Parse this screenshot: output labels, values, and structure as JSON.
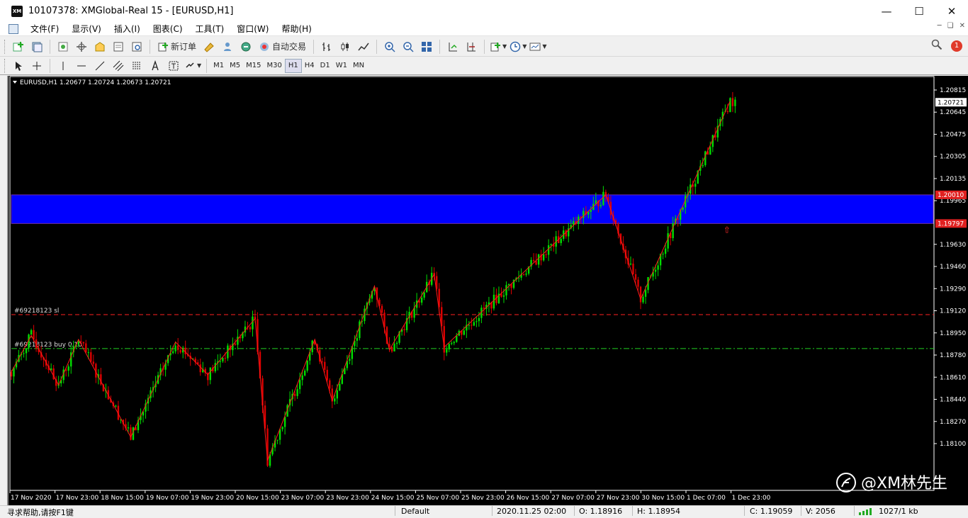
{
  "window": {
    "title": "10107378: XMGlobal-Real 15 - [EURUSD,H1]",
    "app_badge": "XM"
  },
  "menu": [
    "文件(F)",
    "显示(V)",
    "插入(I)",
    "图表(C)",
    "工具(T)",
    "窗口(W)",
    "帮助(H)"
  ],
  "toolbar": {
    "new_order_label": "新订单",
    "auto_trading_label": "自动交易",
    "notification_count": "1",
    "timeframes": [
      "M1",
      "M5",
      "M15",
      "M30",
      "H1",
      "H4",
      "D1",
      "W1",
      "MN"
    ],
    "active_timeframe": "H1"
  },
  "chart_data": {
    "type": "candlestick",
    "symbol_header": "EURUSD,H1  1.20677 1.20724 1.20673 1.20721",
    "price_ticks": [
      "1.20815",
      "1.20645",
      "1.20475",
      "1.20305",
      "1.20135",
      "1.19965",
      "1.19630",
      "1.19460",
      "1.19290",
      "1.19120",
      "1.18950",
      "1.18780",
      "1.18610",
      "1.18440",
      "1.18270",
      "1.18100"
    ],
    "price_tick_values": [
      1.20815,
      1.20645,
      1.20475,
      1.20305,
      1.20135,
      1.19965,
      1.1963,
      1.1946,
      1.1929,
      1.1912,
      1.1895,
      1.1878,
      1.1861,
      1.1844,
      1.1827,
      1.181
    ],
    "time_labels": [
      "17 Nov 2020",
      "17 Nov 23:00",
      "18 Nov 15:00",
      "19 Nov 07:00",
      "19 Nov 23:00",
      "20 Nov 15:00",
      "23 Nov 07:00",
      "23 Nov 23:00",
      "24 Nov 15:00",
      "25 Nov 07:00",
      "25 Nov 23:00",
      "26 Nov 15:00",
      "27 Nov 07:00",
      "27 Nov 23:00",
      "30 Nov 15:00",
      "1 Dec 07:00",
      "1 Dec 23:00"
    ],
    "current_price_label": "1.20721",
    "current_price": 1.20721,
    "zone": {
      "top": 1.2001,
      "bottom": 1.1979,
      "top_label": "1.20010",
      "bottom_label": "1.19797",
      "color": "#0000ff"
    },
    "order_lines": [
      {
        "label": "#69218123 sl",
        "price": 1.1909,
        "color": "#ff2020",
        "style": "dash"
      },
      {
        "label": "#69218123 buy 0.10",
        "price": 1.1883,
        "color": "#20d020",
        "style": "dashdot"
      }
    ],
    "zigzag": [
      [
        0,
        1.1865
      ],
      [
        8,
        1.1893
      ],
      [
        19,
        1.1855
      ],
      [
        27,
        1.189
      ],
      [
        48,
        1.1815
      ],
      [
        66,
        1.1888
      ],
      [
        79,
        1.1863
      ],
      [
        98,
        1.1906
      ],
      [
        103,
        1.1797
      ],
      [
        122,
        1.189
      ],
      [
        129,
        1.1843
      ],
      [
        146,
        1.1931
      ],
      [
        152,
        1.1882
      ],
      [
        170,
        1.194
      ],
      [
        174,
        1.1884
      ],
      [
        239,
        1.2001
      ],
      [
        253,
        1.1921
      ],
      [
        289,
        1.2073
      ]
    ],
    "bull_color": "#00dd00",
    "bear_color": "#dd0000",
    "arrow_label": "⇧",
    "watermark": "@XM林先生"
  },
  "status": {
    "help": "寻求帮助,请按F1键",
    "profile": "Default",
    "datetime": "2020.11.25 02:00",
    "open": "O: 1.18916",
    "high": "H: 1.18954",
    "close": "C: 1.19059",
    "volume": "V: 2056",
    "traffic": "1027/1 kb"
  }
}
